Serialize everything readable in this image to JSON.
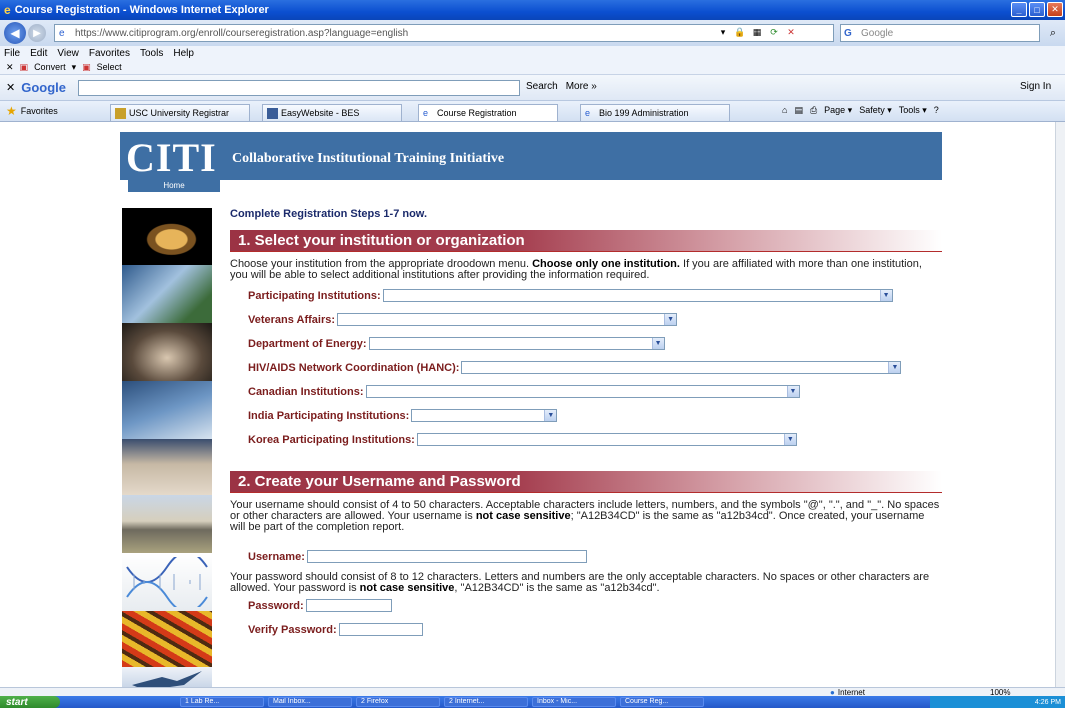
{
  "browser": {
    "title": "Course Registration - Windows Internet Explorer",
    "url": "https://www.citiprogram.org/enroll/courseregistration.asp?language=english",
    "search_placeholder": "Google",
    "menu": [
      "File",
      "Edit",
      "View",
      "Favorites",
      "Tools",
      "Help"
    ],
    "convert_label": "Convert",
    "select_label": "Select",
    "google_label": "Google",
    "google_search_label": "Search",
    "google_more_label": "More »",
    "sign_in_label": "Sign In",
    "favorites_label": "Favorites",
    "tabs": [
      {
        "label": "USC University Registrar"
      },
      {
        "label": "EasyWebsite - BES"
      },
      {
        "label": "Course Registration"
      },
      {
        "label": "Bio 199 Administration"
      }
    ],
    "commands": [
      "Page ▾",
      "Safety ▾",
      "Tools ▾"
    ],
    "status_zone": "Internet",
    "zoom": "100%"
  },
  "site": {
    "logo": "CITI",
    "logo_full": "Collaborative Institutional Training Initiative",
    "home_label": "Home"
  },
  "form": {
    "intro": "Complete Registration Steps 1-7 now.",
    "section1": {
      "title": "1. Select your institution or organization",
      "text_a": "Choose your institution from the appropriate droodown menu. ",
      "text_b": "Choose only one institution.",
      "text_c": " If you are affiliated with more than one institution, you will be able to select additional institutions after providing the information required.",
      "fields": {
        "participating": "Participating Institutions:",
        "veterans": "Veterans Affairs:",
        "energy": "Department of Energy:",
        "hanc": "HIV/AIDS Network Coordination (HANC):",
        "canadian": "Canadian Institutions:",
        "india": "India Participating Institutions:",
        "korea": "Korea Participating Institutions:"
      }
    },
    "section2": {
      "title": "2. Create your Username and Password",
      "username_text_a": "Your username should consist of 4 to 50 characters. Acceptable characters include letters, numbers, and the symbols \"@\", \".\", and \"_\". No spaces or other characters are allowed. Your username is ",
      "username_text_b": "not case sensitive",
      "username_text_c": "; \"A12B34CD\" is the same as \"a12b34cd\". Once created, your username will be part of the completion report.",
      "username_label": "Username:",
      "password_text_a": "Your password should consist of 8 to 12 characters. Letters and numbers are the only acceptable characters. No spaces or other characters are allowed. Your password is ",
      "password_text_b": "not case sensitive",
      "password_text_c": ", \"A12B34CD\" is the same as \"a12b34cd\".",
      "password_label": "Password:",
      "verify_label": "Verify Password:"
    }
  },
  "taskbar": {
    "start": "start",
    "tasks": [
      "1 Lab Re...",
      "Mail Inbox...",
      "2 Firefox",
      "2 Internet...",
      "Inbox - Mic...",
      "Course Reg..."
    ],
    "tray": "4:26 PM"
  }
}
